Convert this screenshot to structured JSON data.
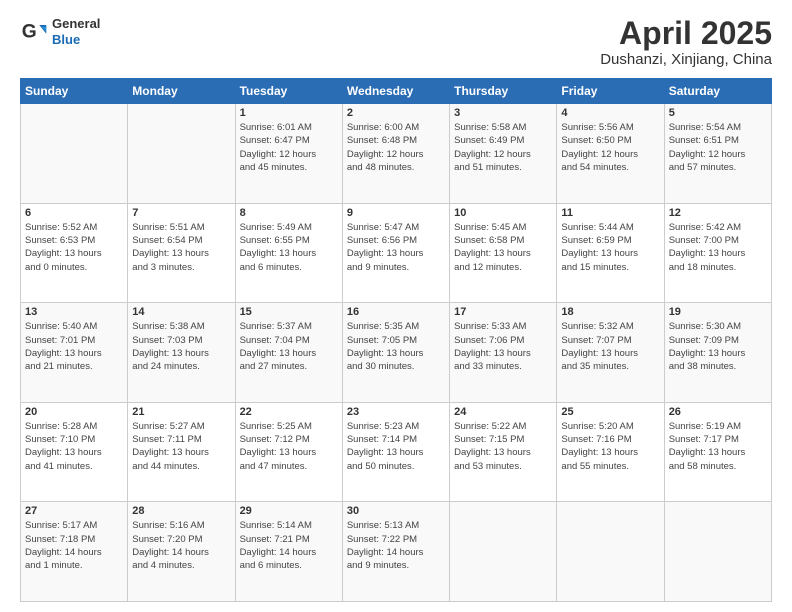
{
  "header": {
    "logo_general": "General",
    "logo_blue": "Blue",
    "month_title": "April 2025",
    "location": "Dushanzi, Xinjiang, China"
  },
  "weekdays": [
    "Sunday",
    "Monday",
    "Tuesday",
    "Wednesday",
    "Thursday",
    "Friday",
    "Saturday"
  ],
  "weeks": [
    [
      {
        "day": "",
        "content": ""
      },
      {
        "day": "",
        "content": ""
      },
      {
        "day": "1",
        "content": "Sunrise: 6:01 AM\nSunset: 6:47 PM\nDaylight: 12 hours\nand 45 minutes."
      },
      {
        "day": "2",
        "content": "Sunrise: 6:00 AM\nSunset: 6:48 PM\nDaylight: 12 hours\nand 48 minutes."
      },
      {
        "day": "3",
        "content": "Sunrise: 5:58 AM\nSunset: 6:49 PM\nDaylight: 12 hours\nand 51 minutes."
      },
      {
        "day": "4",
        "content": "Sunrise: 5:56 AM\nSunset: 6:50 PM\nDaylight: 12 hours\nand 54 minutes."
      },
      {
        "day": "5",
        "content": "Sunrise: 5:54 AM\nSunset: 6:51 PM\nDaylight: 12 hours\nand 57 minutes."
      }
    ],
    [
      {
        "day": "6",
        "content": "Sunrise: 5:52 AM\nSunset: 6:53 PM\nDaylight: 13 hours\nand 0 minutes."
      },
      {
        "day": "7",
        "content": "Sunrise: 5:51 AM\nSunset: 6:54 PM\nDaylight: 13 hours\nand 3 minutes."
      },
      {
        "day": "8",
        "content": "Sunrise: 5:49 AM\nSunset: 6:55 PM\nDaylight: 13 hours\nand 6 minutes."
      },
      {
        "day": "9",
        "content": "Sunrise: 5:47 AM\nSunset: 6:56 PM\nDaylight: 13 hours\nand 9 minutes."
      },
      {
        "day": "10",
        "content": "Sunrise: 5:45 AM\nSunset: 6:58 PM\nDaylight: 13 hours\nand 12 minutes."
      },
      {
        "day": "11",
        "content": "Sunrise: 5:44 AM\nSunset: 6:59 PM\nDaylight: 13 hours\nand 15 minutes."
      },
      {
        "day": "12",
        "content": "Sunrise: 5:42 AM\nSunset: 7:00 PM\nDaylight: 13 hours\nand 18 minutes."
      }
    ],
    [
      {
        "day": "13",
        "content": "Sunrise: 5:40 AM\nSunset: 7:01 PM\nDaylight: 13 hours\nand 21 minutes."
      },
      {
        "day": "14",
        "content": "Sunrise: 5:38 AM\nSunset: 7:03 PM\nDaylight: 13 hours\nand 24 minutes."
      },
      {
        "day": "15",
        "content": "Sunrise: 5:37 AM\nSunset: 7:04 PM\nDaylight: 13 hours\nand 27 minutes."
      },
      {
        "day": "16",
        "content": "Sunrise: 5:35 AM\nSunset: 7:05 PM\nDaylight: 13 hours\nand 30 minutes."
      },
      {
        "day": "17",
        "content": "Sunrise: 5:33 AM\nSunset: 7:06 PM\nDaylight: 13 hours\nand 33 minutes."
      },
      {
        "day": "18",
        "content": "Sunrise: 5:32 AM\nSunset: 7:07 PM\nDaylight: 13 hours\nand 35 minutes."
      },
      {
        "day": "19",
        "content": "Sunrise: 5:30 AM\nSunset: 7:09 PM\nDaylight: 13 hours\nand 38 minutes."
      }
    ],
    [
      {
        "day": "20",
        "content": "Sunrise: 5:28 AM\nSunset: 7:10 PM\nDaylight: 13 hours\nand 41 minutes."
      },
      {
        "day": "21",
        "content": "Sunrise: 5:27 AM\nSunset: 7:11 PM\nDaylight: 13 hours\nand 44 minutes."
      },
      {
        "day": "22",
        "content": "Sunrise: 5:25 AM\nSunset: 7:12 PM\nDaylight: 13 hours\nand 47 minutes."
      },
      {
        "day": "23",
        "content": "Sunrise: 5:23 AM\nSunset: 7:14 PM\nDaylight: 13 hours\nand 50 minutes."
      },
      {
        "day": "24",
        "content": "Sunrise: 5:22 AM\nSunset: 7:15 PM\nDaylight: 13 hours\nand 53 minutes."
      },
      {
        "day": "25",
        "content": "Sunrise: 5:20 AM\nSunset: 7:16 PM\nDaylight: 13 hours\nand 55 minutes."
      },
      {
        "day": "26",
        "content": "Sunrise: 5:19 AM\nSunset: 7:17 PM\nDaylight: 13 hours\nand 58 minutes."
      }
    ],
    [
      {
        "day": "27",
        "content": "Sunrise: 5:17 AM\nSunset: 7:18 PM\nDaylight: 14 hours\nand 1 minute."
      },
      {
        "day": "28",
        "content": "Sunrise: 5:16 AM\nSunset: 7:20 PM\nDaylight: 14 hours\nand 4 minutes."
      },
      {
        "day": "29",
        "content": "Sunrise: 5:14 AM\nSunset: 7:21 PM\nDaylight: 14 hours\nand 6 minutes."
      },
      {
        "day": "30",
        "content": "Sunrise: 5:13 AM\nSunset: 7:22 PM\nDaylight: 14 hours\nand 9 minutes."
      },
      {
        "day": "",
        "content": ""
      },
      {
        "day": "",
        "content": ""
      },
      {
        "day": "",
        "content": ""
      }
    ]
  ]
}
